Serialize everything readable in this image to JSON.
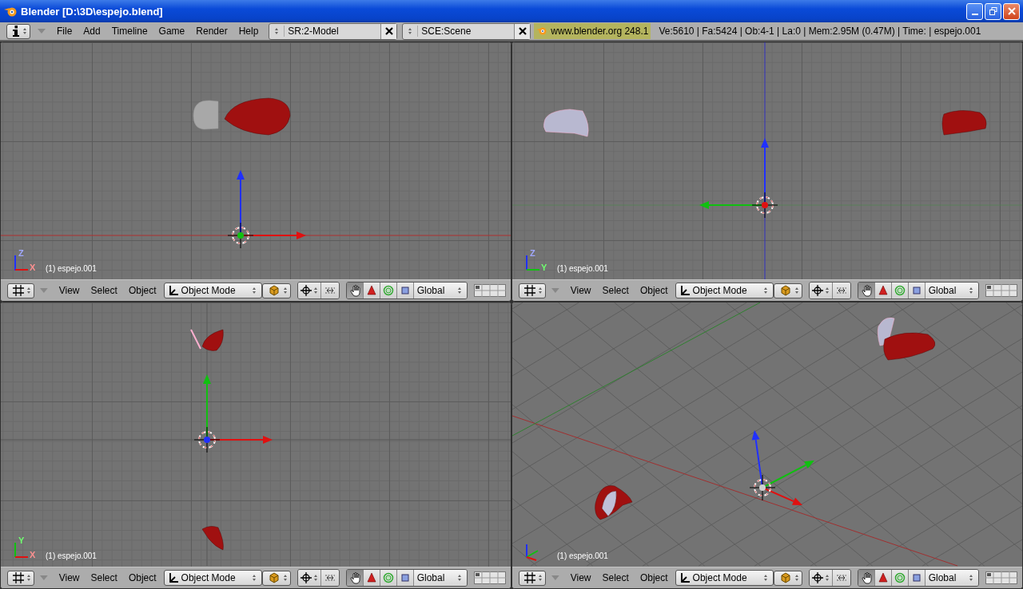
{
  "window": {
    "title": "Blender [D:\\3D\\espejo.blend]"
  },
  "top_bar": {
    "menus": [
      "File",
      "Add",
      "Timeline",
      "Game",
      "Render",
      "Help"
    ],
    "screen": "SR:2-Model",
    "scene": "SCE:Scene",
    "version": "www.blender.org 248.1",
    "stats": "Ve:5610 | Fa:5424 | Ob:4-1 | La:0  | Mem:2.95M (0.47M)  | Time: | espejo.001"
  },
  "viewports": [
    {
      "kind": "front",
      "object_label": "(1) espejo.001",
      "axis_letters": [
        "Z",
        "X"
      ],
      "header": {
        "menus": [
          "View",
          "Select",
          "Object"
        ],
        "mode": "Object Mode",
        "orientation": "Global",
        "manipulators": [
          {
            "kind": "hand",
            "selected": true
          },
          {
            "kind": "translate",
            "selected": false
          },
          {
            "kind": "rotate",
            "selected": false
          },
          {
            "kind": "scale",
            "selected": false
          }
        ]
      }
    },
    {
      "kind": "side",
      "object_label": "(1) espejo.001",
      "axis_letters": [
        "Z",
        "Y"
      ],
      "header": {
        "menus": [
          "View",
          "Select",
          "Object"
        ],
        "mode": "Object Mode",
        "orientation": "Global",
        "manipulators": [
          {
            "kind": "hand",
            "selected": true
          },
          {
            "kind": "translate",
            "selected": false
          },
          {
            "kind": "rotate",
            "selected": false
          },
          {
            "kind": "scale",
            "selected": false
          }
        ]
      }
    },
    {
      "kind": "top",
      "object_label": "(1) espejo.001",
      "axis_letters": [
        "Y",
        "X"
      ],
      "header": {
        "menus": [
          "View",
          "Select",
          "Object"
        ],
        "mode": "Object Mode",
        "orientation": "Global",
        "manipulators": [
          {
            "kind": "hand",
            "selected": true
          },
          {
            "kind": "translate",
            "selected": false
          },
          {
            "kind": "rotate",
            "selected": false
          },
          {
            "kind": "scale",
            "selected": false
          }
        ]
      }
    },
    {
      "kind": "perspective",
      "object_label": "(1) espejo.001",
      "header": {
        "menus": [
          "View",
          "Select",
          "Object"
        ],
        "mode": "Object Mode",
        "orientation": "Global",
        "manipulators": [
          {
            "kind": "hand",
            "selected": true
          },
          {
            "kind": "translate",
            "selected": false
          },
          {
            "kind": "rotate",
            "selected": false
          },
          {
            "kind": "scale",
            "selected": false
          }
        ]
      }
    }
  ]
}
